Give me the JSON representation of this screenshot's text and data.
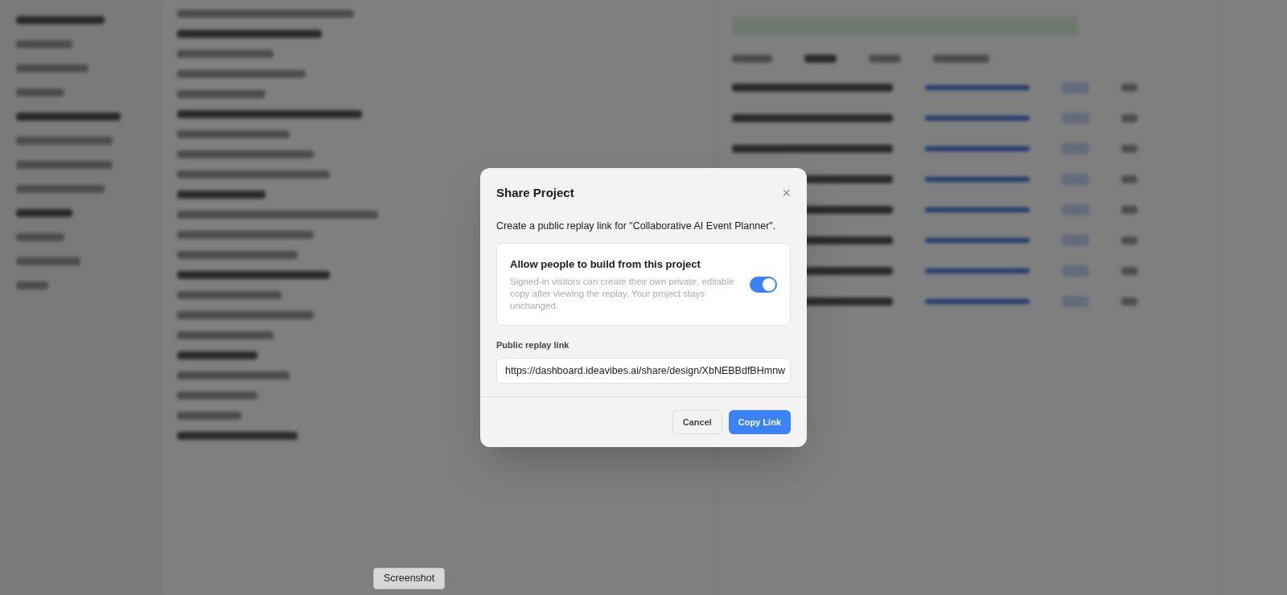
{
  "dialog": {
    "title": "Share Project",
    "close_icon": "×",
    "description": "Create a public replay link for \"Collaborative AI Event Planner\".",
    "option": {
      "title": "Allow people to build from this project",
      "description": "Signed-in visitors can create their own private, editable copy after viewing the replay. Your project stays unchanged.",
      "on": true
    },
    "link_label": "Public replay link",
    "link_value": "https://dashboard.ideavibes.ai/share/design/XbNEBBdfBHmnw",
    "buttons": [
      {
        "label": "Cancel",
        "kind": "secondary"
      },
      {
        "label": "Copy Link",
        "kind": "primary"
      }
    ]
  },
  "tasks": [
    {
      "level": 1
    },
    {
      "level": 1
    },
    {
      "level": 1
    },
    {
      "level": 1
    },
    {
      "level": 1
    },
    {
      "level": 1
    },
    {
      "level": 1
    },
    {
      "level": 1
    }
  ],
  "tooltip": "Screenshot"
}
